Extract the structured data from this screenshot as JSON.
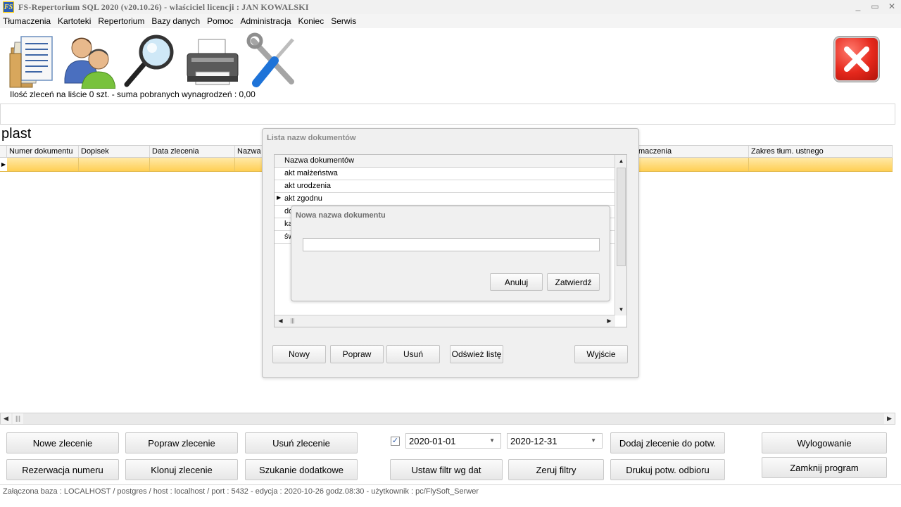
{
  "window": {
    "logo": "FS",
    "title": "FS-Repertorium SQL 2020  (v20.10.26)    -     właściciel licencji :   JAN KOWALSKI",
    "controls": [
      "minimize-icon",
      "restore-icon",
      "close-icon"
    ]
  },
  "menu": [
    "Tłumaczenia",
    "Kartoteki",
    "Repertorium",
    "Bazy danych",
    "Pomoc",
    "Administracja",
    "Koniec",
    "Serwis"
  ],
  "toolbar": {
    "icons": [
      "documents-icon",
      "users-icon",
      "search-icon",
      "printer-icon",
      "tools-icon"
    ],
    "summary": "Ilość zleceń na liście 0 szt.  -  suma pobranych wynagrodzeń : 0,00",
    "exit_icon": "close-icon"
  },
  "section_title": "plast",
  "grid": {
    "columns": [
      "Numer dokumentu",
      "Dopisek",
      "Data zlecenia",
      "Nazwa",
      "maczenia",
      "Zakres tłum. ustnego"
    ]
  },
  "list_dialog": {
    "title": "Lista nazw dokumentów",
    "header": "Nazwa dokumentów",
    "items": [
      "akt małżeństwa",
      "akt urodzenia",
      "akt zgodnu",
      "do",
      "ka",
      "św"
    ],
    "selected_index": 2,
    "buttons": {
      "new": "Nowy",
      "edit": "Popraw",
      "delete": "Usuń",
      "refresh": "Odśwież listę",
      "exit": "Wyjście"
    }
  },
  "new_name_dialog": {
    "title": "Nowa nazwa dokumentu",
    "input_value": "",
    "cancel": "Anuluj",
    "confirm": "Zatwierdź"
  },
  "bottom": {
    "new_order": "Nowe zlecenie",
    "edit_order": "Popraw zlecenie",
    "delete_order": "Usuń zlecenie",
    "reserve_number": "Rezerwacja numeru",
    "clone_order": "Klonuj zlecenie",
    "extra_search": "Szukanie dodatkowe",
    "date_filter_checked": true,
    "date_from": "2020-01-01",
    "date_to": "2020-12-31",
    "set_date_filter": "Ustaw filtr wg dat",
    "reset_filters": "Zeruj filtry",
    "add_to_confirm": "Dodaj zlecenie do potw.",
    "print_receipt": "Drukuj potw. odbioru",
    "logout": "Wylogowanie",
    "close_program": "Zamknij program"
  },
  "status": "Załączona baza : LOCALHOST  /  postgres /  host : localhost  /  port : 5432  -   edycja : 2020-10-26  godz.08:30   -   użytkownik : pc/FlySoft_Serwer"
}
